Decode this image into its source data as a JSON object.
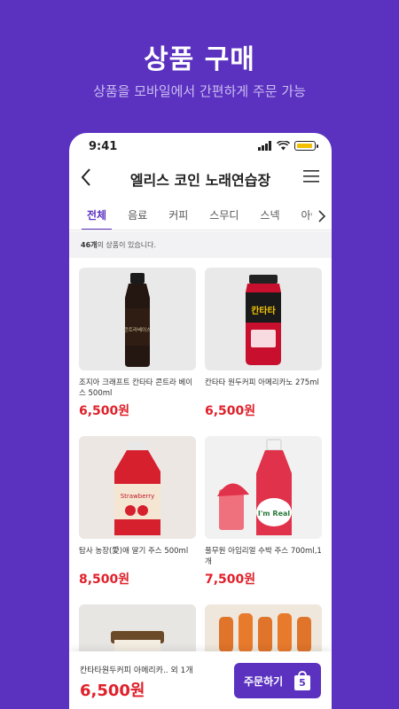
{
  "hero": {
    "title": "상품 구매",
    "subtitle": "상품을 모바일에서 간편하게 주문 가능"
  },
  "status": {
    "time": "9:41"
  },
  "header": {
    "store_name": "엘리스 코인 노래연습장"
  },
  "tabs": [
    "전체",
    "음료",
    "커피",
    "스무디",
    "스넥",
    "아이스"
  ],
  "count": {
    "number": "46개",
    "suffix": "의 상품이 있습니다."
  },
  "products": [
    {
      "name": "조지아 크래프트 칸타타 콘트라 베이스 500ml",
      "price": "6,500원"
    },
    {
      "name": "칸타타 원두커피 아메리카노 275ml",
      "price": "6,500원"
    },
    {
      "name": "탐사 농장(愛)애 딸기 주스 500ml",
      "price": "8,500원"
    },
    {
      "name": "풀무원 아임리얼 수박 주스 700ml,1개",
      "price": "7,500원"
    }
  ],
  "product_labels": {
    "coffee_brand": "콘트라베이스",
    "cantata": "칸타타",
    "strawberry": "Strawberry",
    "imreal": "I'm Real"
  },
  "cart": {
    "selected": "칸타타원두커피 아메리카.. 외 1개",
    "price": "6,500원",
    "order_label": "주문하기",
    "count": "5"
  },
  "colors": {
    "accent": "#5b32c0",
    "price": "#e0202a"
  }
}
